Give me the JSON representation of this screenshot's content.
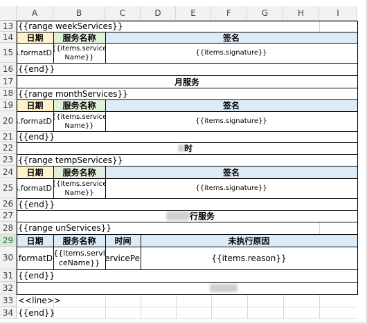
{
  "columns": [
    "A",
    "B",
    "C",
    "D",
    "E",
    "F",
    "G",
    "H",
    "I"
  ],
  "rows": [
    "13",
    "14",
    "15",
    "16",
    "17",
    "18",
    "19",
    "20",
    "21",
    "22",
    "23",
    "24",
    "25",
    "26",
    "27",
    "28",
    "29",
    "30",
    "31",
    "32",
    "33",
    "34"
  ],
  "templates": {
    "range_week": "{{range weekServices}}",
    "range_month": "{{range monthServices}}",
    "range_temp": "{{range tempServices}}",
    "range_un": "{{range unServices}}",
    "end": "{{end}}",
    "line": "<<line>>"
  },
  "headers": {
    "date": "日期",
    "service_name": "服务名称",
    "signature": "签名",
    "time": "时间",
    "reason": "未执行原因"
  },
  "cells": {
    "format_date": "ms.formatD",
    "format_date_wide": "ms.formatD",
    "service_name_1": "{{items.service",
    "service_name_2": "Name}}",
    "service_name_alt_1": "{{items.servi",
    "service_name_alt_2": "ceName}}",
    "signature": "{{items.signature}}",
    "service_period": "s.servicePe",
    "reason": "{{items.reason}}"
  },
  "sections": {
    "monthly": "月服务",
    "temporary": "时",
    "unexecuted": "行服务"
  }
}
